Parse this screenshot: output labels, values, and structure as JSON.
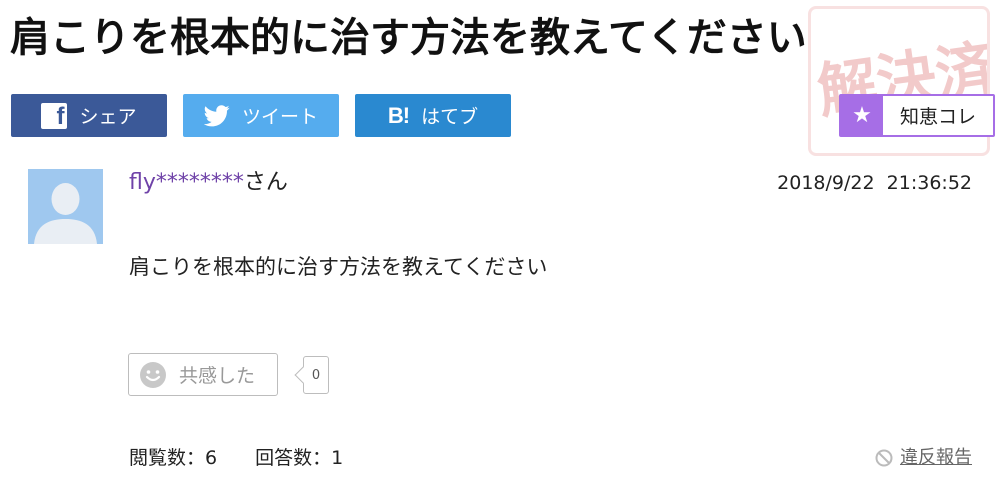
{
  "question": {
    "title": "肩こりを根本的に治す方法を教えてください",
    "body": "肩こりを根本的に治す方法を教えてください",
    "author_name": "fly********",
    "author_suffix": "さん",
    "posted_at": "2018/9/22  21:36:52"
  },
  "share_buttons": {
    "facebook_label": "シェア",
    "twitter_label": "ツイート",
    "hatena_label": "はてブ",
    "hatena_icon_text": "B!",
    "facebook_icon_text": "f"
  },
  "chiebukuro_collection": {
    "label": "知恵コレ",
    "icon": "star-icon",
    "accent_color": "#a66ee6"
  },
  "stamp": {
    "text": "解決済",
    "color": "#e8a0a0"
  },
  "empathy": {
    "label": "共感した",
    "count": "0"
  },
  "stats": {
    "views": "閲覧数：6",
    "answers": "回答数：1"
  },
  "report": {
    "label": "違反報告"
  },
  "colors": {
    "facebook": "#3b5998",
    "twitter": "#55acee",
    "hatena": "#2a89d0",
    "username": "#6f42a8",
    "avatar_bg": "#9fc8ef"
  }
}
